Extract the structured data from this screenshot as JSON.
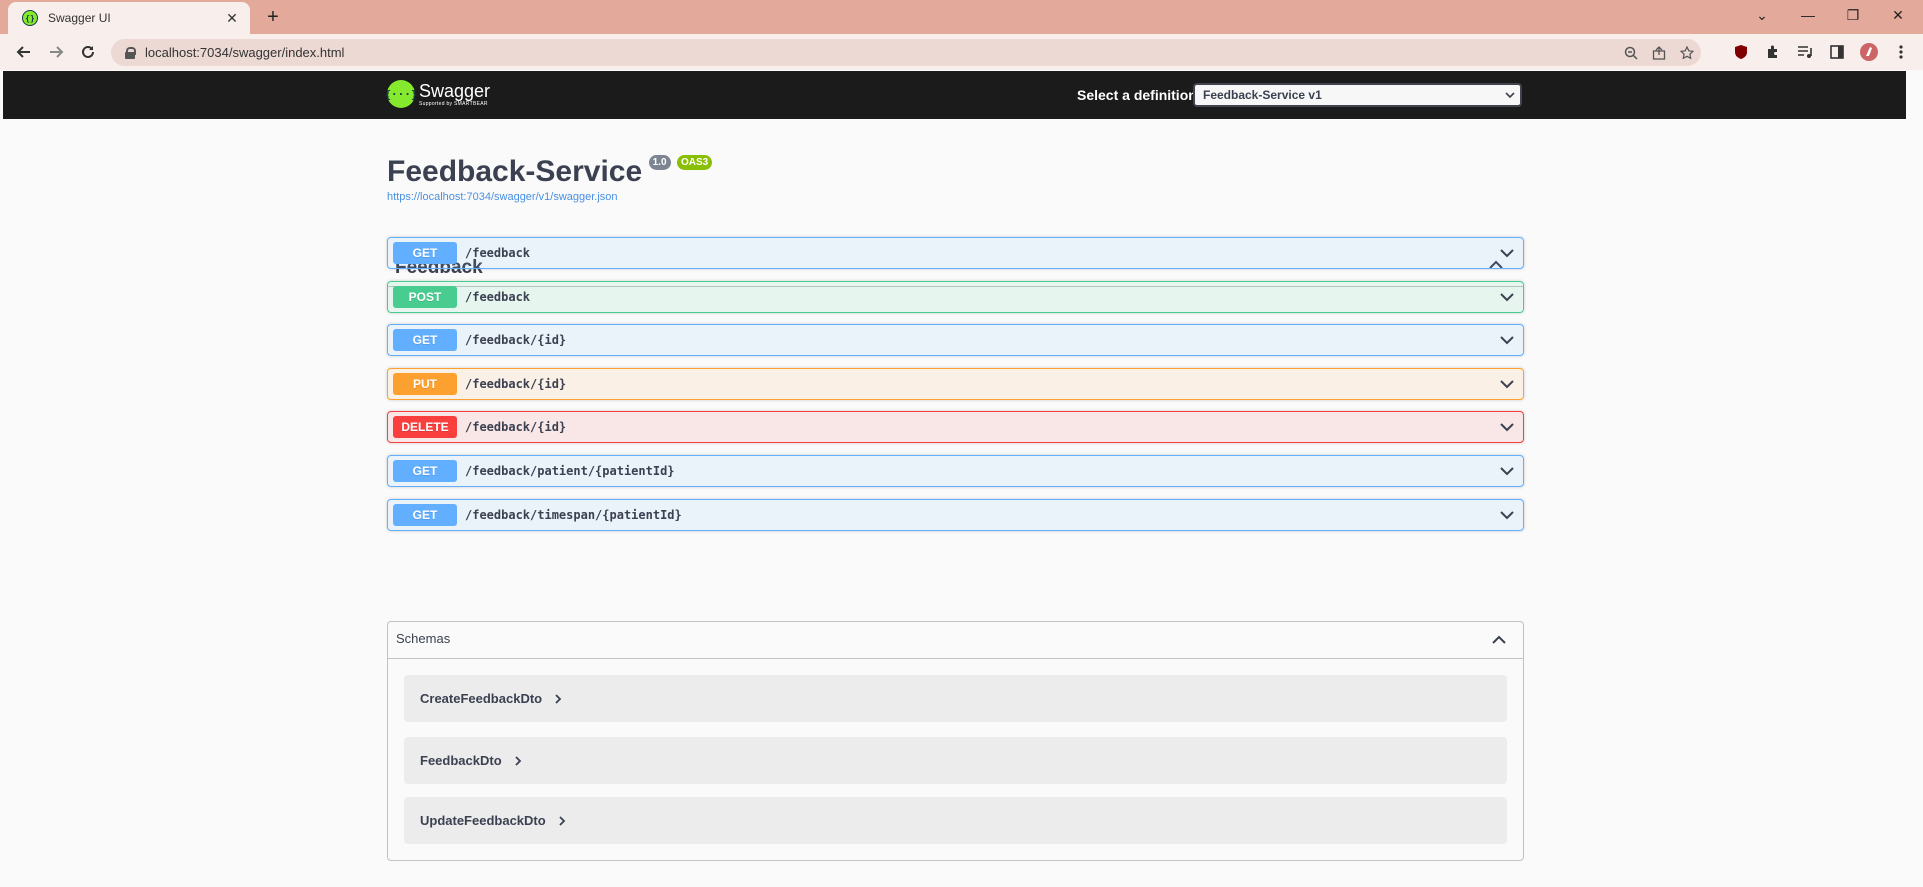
{
  "browser": {
    "tab_title": "Swagger UI",
    "tab_close": "✕",
    "new_tab": "+",
    "url": "localhost:7034/swagger/index.html",
    "window_controls": {
      "minimize": "—",
      "restore": "❐",
      "close": "✕",
      "tab_search": "⌄"
    }
  },
  "swagger": {
    "logo_name": "Swagger",
    "logo_sub": "Supported by SMARTBEAR",
    "definition_label": "Select a definition",
    "definition_value": "Feedback-Service v1"
  },
  "info": {
    "title": "Feedback-Service",
    "version": "1.0",
    "oas": "OAS3",
    "spec_url": "https://localhost:7034/swagger/v1/swagger.json"
  },
  "tag": {
    "name": "Feedback"
  },
  "operations": [
    {
      "method": "GET",
      "path": "/feedback"
    },
    {
      "method": "POST",
      "path": "/feedback"
    },
    {
      "method": "GET",
      "path": "/feedback/{id}"
    },
    {
      "method": "PUT",
      "path": "/feedback/{id}"
    },
    {
      "method": "DELETE",
      "path": "/feedback/{id}"
    },
    {
      "method": "GET",
      "path": "/feedback/patient/{patientId}"
    },
    {
      "method": "GET",
      "path": "/feedback/timespan/{patientId}"
    }
  ],
  "schemas": {
    "title": "Schemas",
    "items": [
      "CreateFeedbackDto",
      "FeedbackDto",
      "UpdateFeedbackDto"
    ]
  },
  "colors": {
    "get": "#61affe",
    "post": "#49cc90",
    "put": "#fca130",
    "delete": "#f93e3e",
    "tabbar": "#e3a99b",
    "swagger_topbar": "#1b1b1b",
    "swagger_green": "#85ea2d"
  }
}
